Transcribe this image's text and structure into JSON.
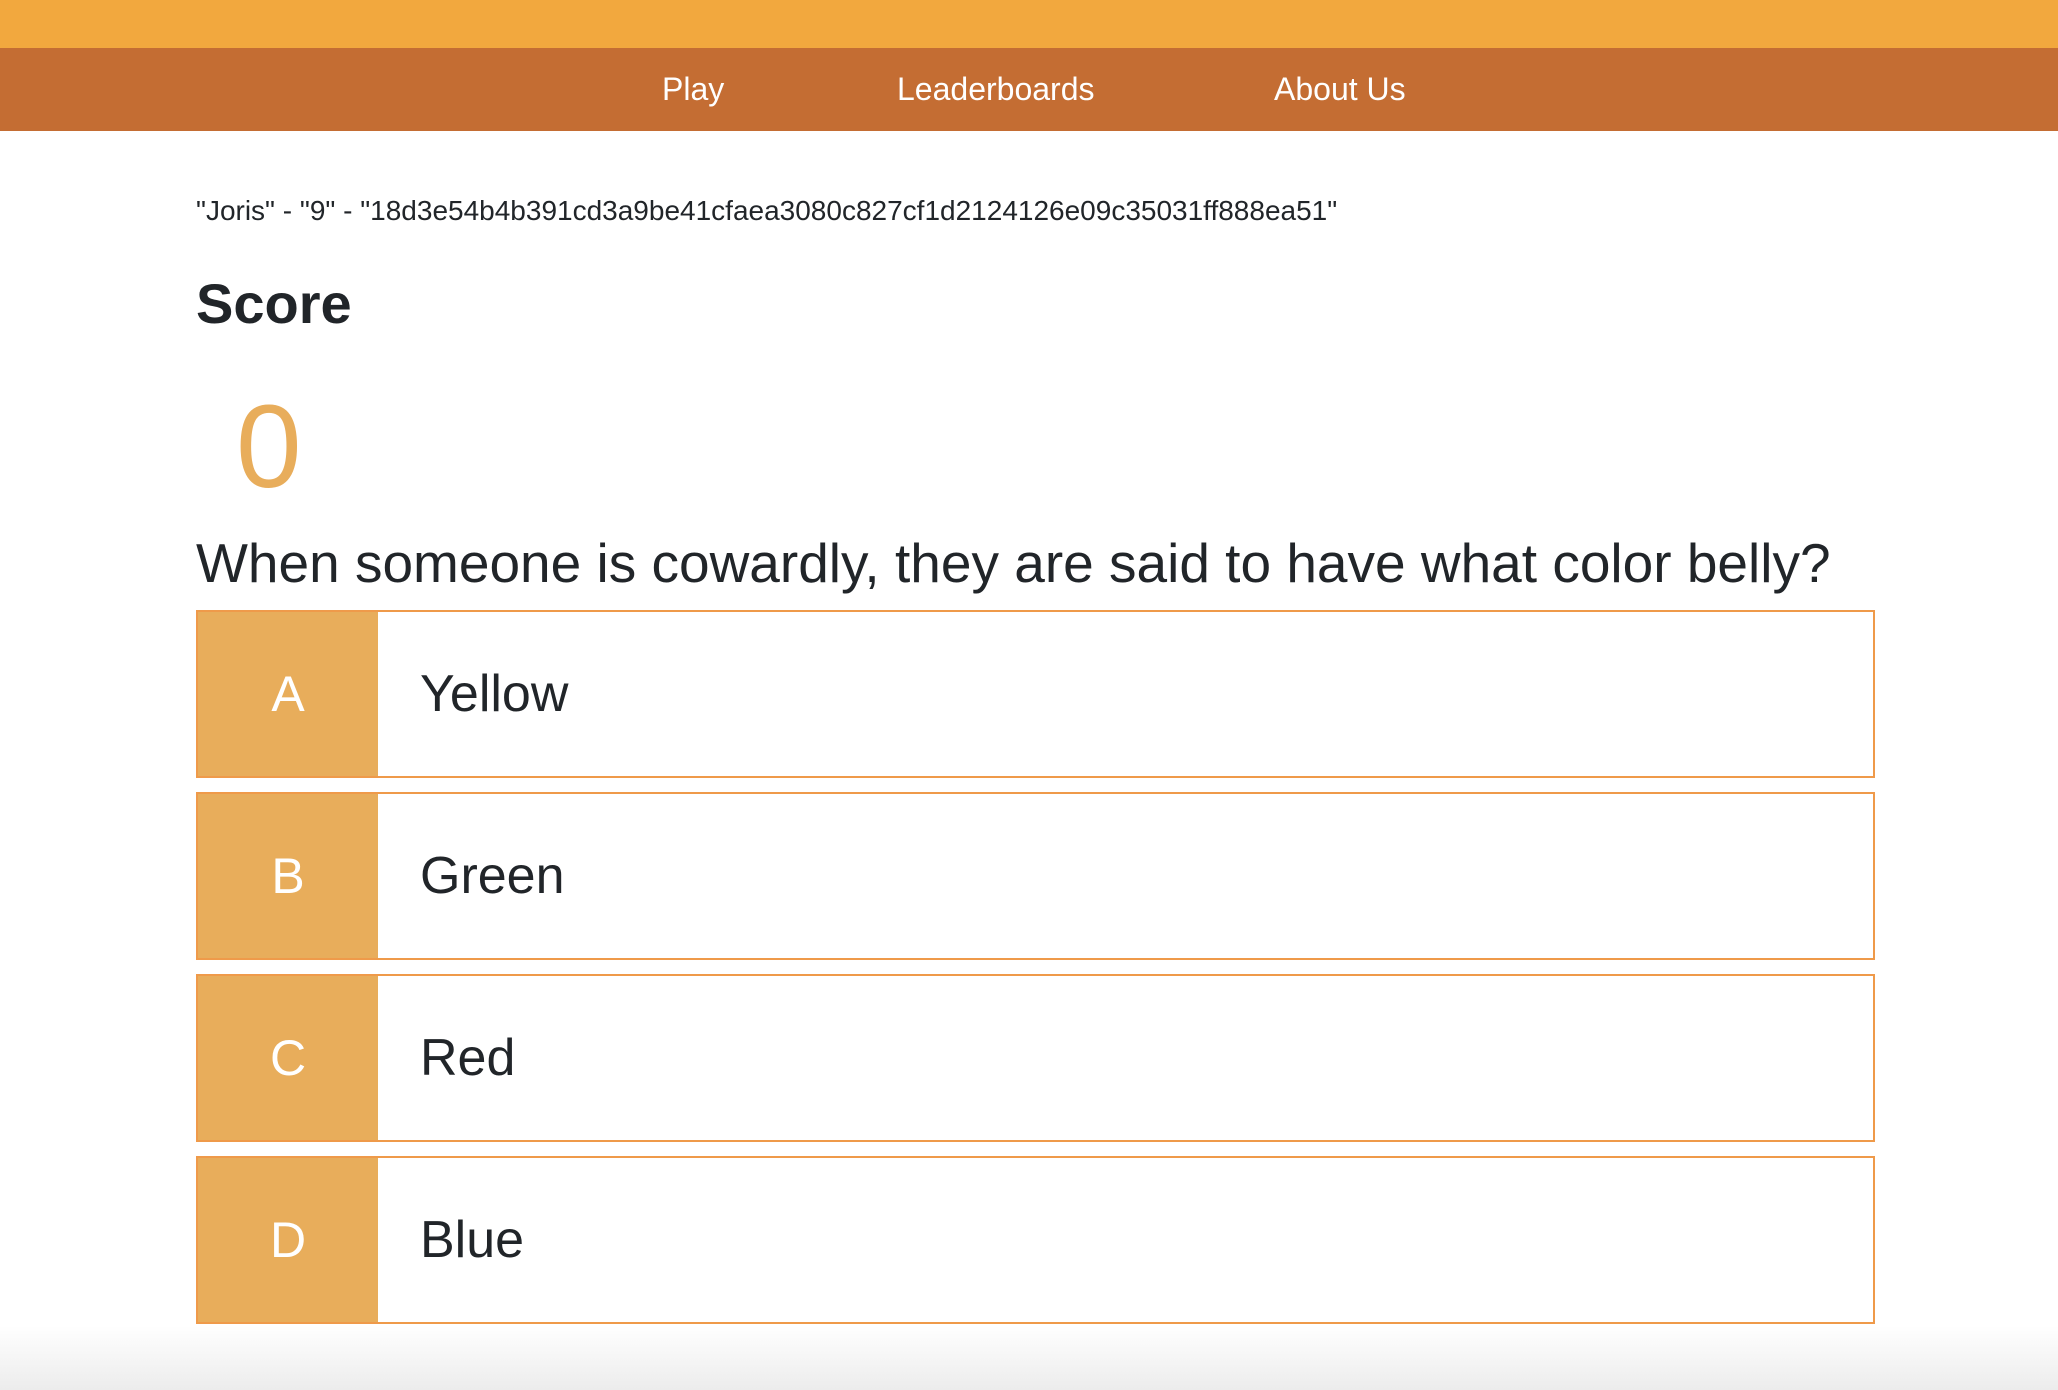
{
  "nav": {
    "items": [
      {
        "label": "Play"
      },
      {
        "label": "Leaderboards"
      },
      {
        "label": "About Us"
      }
    ]
  },
  "player_info": "\"Joris\" - \"9\" - \"18d3e54b4b391cd3a9be41cfaea3080c827cf1d2124126e09c35031ff888ea51\"",
  "score": {
    "heading": "Score",
    "value": "0"
  },
  "question": "When someone is cowardly, they are said to have what color belly?",
  "answers": [
    {
      "letter": "A",
      "text": "Yellow"
    },
    {
      "letter": "B",
      "text": "Green"
    },
    {
      "letter": "C",
      "text": "Red"
    },
    {
      "letter": "D",
      "text": "Blue"
    }
  ],
  "colors": {
    "top_strip": "#f2a83e",
    "navbar": "#c46d33",
    "accent": "#e8ad5b",
    "answer_border": "#ef9a4a"
  }
}
